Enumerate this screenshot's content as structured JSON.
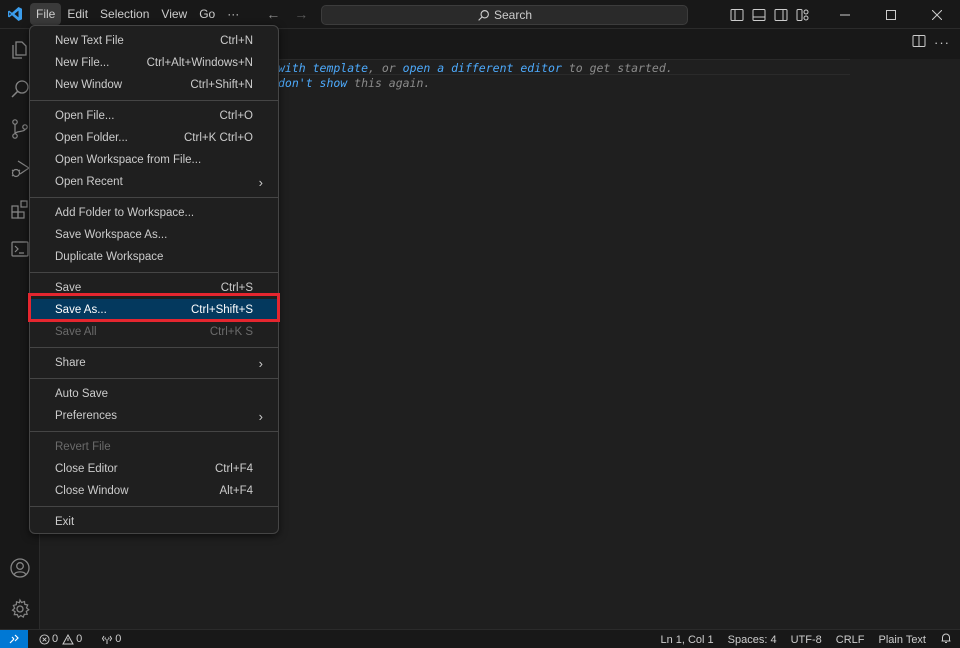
{
  "titlebar": {
    "menus": [
      "File",
      "Edit",
      "Selection",
      "View",
      "Go",
      "···"
    ],
    "active_menu": "File",
    "search_placeholder": "Search",
    "layout_buttons": [
      "toggle-primary-sidebar",
      "toggle-panel",
      "toggle-secondary-sidebar",
      "customize-layout"
    ],
    "window_controls": [
      "minimize",
      "maximize",
      "close"
    ]
  },
  "activitybar": {
    "top": [
      "explorer",
      "search",
      "source-control",
      "run-and-debug",
      "extensions",
      "terminal"
    ],
    "bottom": [
      "accounts",
      "manage"
    ]
  },
  "editor": {
    "hint_line1": [
      {
        "text": "with template",
        "link": true
      },
      {
        "text": ", or ",
        "link": false
      },
      {
        "text": "open a different editor",
        "link": true
      },
      {
        "text": " to get started.",
        "link": false
      }
    ],
    "hint_line2": [
      {
        "text": "don't show",
        "link": true
      },
      {
        "text": " this again.",
        "link": false
      }
    ]
  },
  "file_menu": {
    "groups": [
      [
        {
          "label": "New Text File",
          "shortcut": "Ctrl+N"
        },
        {
          "label": "New File...",
          "shortcut": "Ctrl+Alt+Windows+N"
        },
        {
          "label": "New Window",
          "shortcut": "Ctrl+Shift+N"
        }
      ],
      [
        {
          "label": "Open File...",
          "shortcut": "Ctrl+O"
        },
        {
          "label": "Open Folder...",
          "shortcut": "Ctrl+K Ctrl+O"
        },
        {
          "label": "Open Workspace from File...",
          "shortcut": ""
        },
        {
          "label": "Open Recent",
          "shortcut": "",
          "submenu": true
        }
      ],
      [
        {
          "label": "Add Folder to Workspace...",
          "shortcut": ""
        },
        {
          "label": "Save Workspace As...",
          "shortcut": ""
        },
        {
          "label": "Duplicate Workspace",
          "shortcut": ""
        }
      ],
      [
        {
          "label": "Save",
          "shortcut": "Ctrl+S"
        },
        {
          "label": "Save As...",
          "shortcut": "Ctrl+Shift+S",
          "highlighted": true
        },
        {
          "label": "Save All",
          "shortcut": "Ctrl+K S",
          "disabled": true
        }
      ],
      [
        {
          "label": "Share",
          "shortcut": "",
          "submenu": true
        }
      ],
      [
        {
          "label": "Auto Save",
          "shortcut": ""
        },
        {
          "label": "Preferences",
          "shortcut": "",
          "submenu": true
        }
      ],
      [
        {
          "label": "Revert File",
          "shortcut": "",
          "disabled": true
        },
        {
          "label": "Close Editor",
          "shortcut": "Ctrl+F4"
        },
        {
          "label": "Close Window",
          "shortcut": "Alt+F4"
        }
      ],
      [
        {
          "label": "Exit",
          "shortcut": ""
        }
      ]
    ]
  },
  "statusbar": {
    "errors": "0",
    "warnings": "0",
    "ports": "0",
    "position": "Ln 1, Col 1",
    "indentation": "Spaces: 4",
    "encoding": "UTF-8",
    "eol": "CRLF",
    "language": "Plain Text"
  },
  "colors": {
    "accent": "#0078d4",
    "highlight": "#04395e",
    "annotation_box": "#e5262f",
    "link": "#4daafc"
  }
}
